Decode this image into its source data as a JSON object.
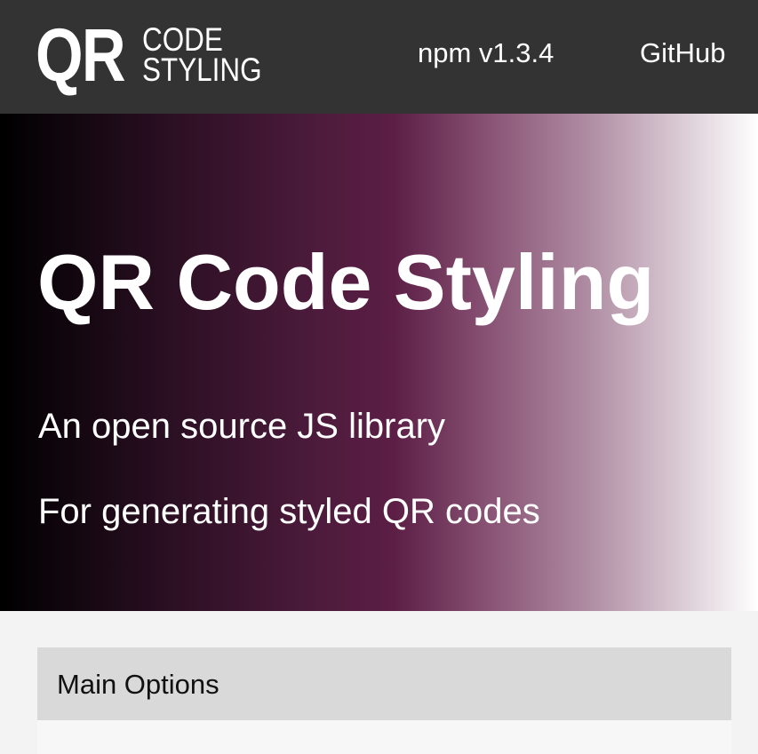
{
  "header": {
    "logo_big": "QR",
    "logo_line1": "CODE",
    "logo_line2": "STYLING",
    "nav": {
      "npm_label": "npm v1.3.4",
      "github_label": "GitHub"
    }
  },
  "hero": {
    "title": "QR Code Styling",
    "subtitle_line1": "An open source JS library",
    "subtitle_line2": "For generating styled QR codes"
  },
  "options": {
    "main_options_label": "Main Options"
  },
  "colors": {
    "header_bg": "#333333",
    "hero_gradient_start": "#000000",
    "hero_gradient_mid": "#5c1e45",
    "hero_gradient_end": "#ffffff",
    "panel_bg": "#d9d9d9",
    "page_bg": "#f3f3f3"
  }
}
